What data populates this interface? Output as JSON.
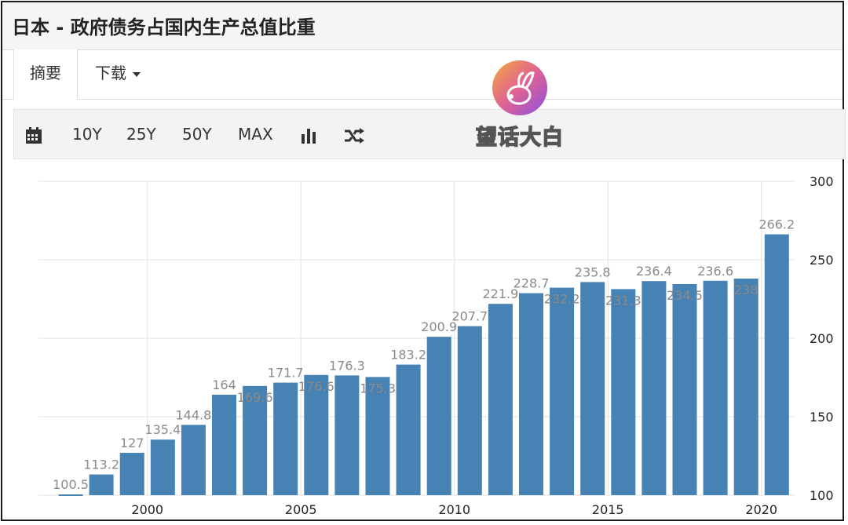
{
  "header": {
    "title": "日本 - 政府债务占国内生产总值比重"
  },
  "tabs": {
    "summary": "摘要",
    "download": "下载"
  },
  "toolbar": {
    "calendar_icon": "calendar-icon",
    "ranges": [
      "10Y",
      "25Y",
      "50Y",
      "MAX"
    ],
    "bar_chart_icon": "bar-chart-icon",
    "shuffle_icon": "shuffle-icon"
  },
  "watermark": {
    "text": "望话大白"
  },
  "colors": {
    "bar": "#4682b4",
    "grid": "#e3e3e3",
    "label": "#8a8a8a"
  },
  "chart_data": {
    "type": "bar",
    "title": "",
    "xlabel": "",
    "ylabel": "",
    "x": [
      1997,
      1998,
      1999,
      2000,
      2001,
      2002,
      2003,
      2004,
      2005,
      2006,
      2007,
      2008,
      2009,
      2010,
      2011,
      2012,
      2013,
      2014,
      2015,
      2016,
      2017,
      2018,
      2019,
      2020
    ],
    "values": [
      100.5,
      113.2,
      127,
      135.4,
      144.8,
      164,
      169.6,
      171.7,
      176.6,
      176.3,
      175.3,
      183.2,
      200.9,
      207.7,
      221.9,
      228.7,
      232.2,
      235.8,
      231.3,
      236.4,
      234.5,
      236.6,
      238,
      266.2
    ],
    "labels": [
      "100.5",
      "113.2",
      "127",
      "135.4",
      "144.8",
      "164",
      "169.6",
      "171.7",
      "176.6",
      "176.3",
      "175.3",
      "183.2",
      "200.9",
      "207.7",
      "221.9",
      "228.7",
      "232.2",
      "235.8",
      "231.3",
      "236.4",
      "234.5",
      "236.6",
      "238",
      "266.2"
    ],
    "x_ticks": [
      "2000",
      "2005",
      "2010",
      "2015",
      "2020"
    ],
    "y_ticks": [
      "100",
      "150",
      "200",
      "250",
      "300"
    ],
    "ylim": [
      100,
      300
    ],
    "y_axis_side": "right",
    "grid": true
  }
}
